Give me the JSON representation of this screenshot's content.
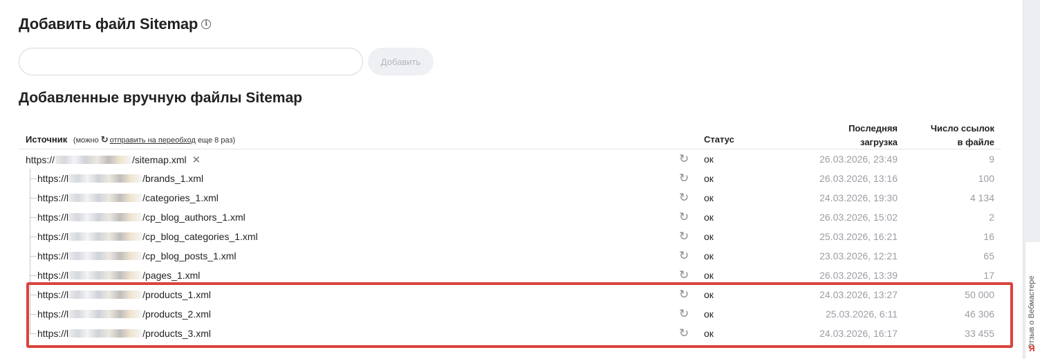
{
  "add_section": {
    "title": "Добавить файл Sitemap",
    "info_icon": "i",
    "input_value": "",
    "input_placeholder": "",
    "add_button_label": "Добавить"
  },
  "list_section": {
    "title": "Добавленные вручную файлы Sitemap"
  },
  "table": {
    "header": {
      "source": "Источник",
      "note_prefix": "(можно",
      "refresh_glyph": "↻",
      "note_link": "отправить на переобход",
      "note_suffix": "еще 8 раз)",
      "status": "Статус",
      "last_load_line1": "Последняя",
      "last_load_line2": "загрузка",
      "links_line1": "Число ссылок",
      "links_line2": "в файле"
    },
    "rows": [
      {
        "url_prefix": "https://",
        "url_suffix": "/sitemap.xml",
        "status": "ок",
        "date": "26.03.2026, 23:49",
        "count": "9",
        "close": "✕"
      },
      {
        "url_prefix": "https://l",
        "url_suffix": "/brands_1.xml",
        "status": "ок",
        "date": "26.03.2026, 13:16",
        "count": "100"
      },
      {
        "url_prefix": "https://l",
        "url_suffix": "/categories_1.xml",
        "status": "ок",
        "date": "24.03.2026, 19:30",
        "count": "4 134"
      },
      {
        "url_prefix": "https://l",
        "url_suffix": "/cp_blog_authors_1.xml",
        "status": "ок",
        "date": "26.03.2026, 15:02",
        "count": "2"
      },
      {
        "url_prefix": "https://l",
        "url_suffix": "/cp_blog_categories_1.xml",
        "status": "ок",
        "date": "25.03.2026, 16:21",
        "count": "16"
      },
      {
        "url_prefix": "https://l",
        "url_suffix": "/cp_blog_posts_1.xml",
        "status": "ок",
        "date": "23.03.2026, 12:21",
        "count": "65"
      },
      {
        "url_prefix": "https://l",
        "url_suffix": "/pages_1.xml",
        "status": "ок",
        "date": "26.03.2026, 13:39",
        "count": "17"
      },
      {
        "url_prefix": "https://l",
        "url_suffix": "/products_1.xml",
        "status": "ок",
        "date": "24.03.2026, 13:27",
        "count": "50 000"
      },
      {
        "url_prefix": "https://l",
        "url_suffix": "/products_2.xml",
        "status": "ок",
        "date": "25.03.2026, 6:11",
        "count": "46 306"
      },
      {
        "url_prefix": "https://l",
        "url_suffix": "/products_3.xml",
        "status": "ок",
        "date": "24.03.2026, 16:17",
        "count": "33 455"
      }
    ]
  },
  "feedback_tab": {
    "label": "Отзыв о Вебмастере",
    "logo": "Я"
  },
  "colors": {
    "highlight_border": "#d9443e",
    "muted_text": "#9a9da3",
    "button_disabled_bg": "#eef0f3"
  }
}
